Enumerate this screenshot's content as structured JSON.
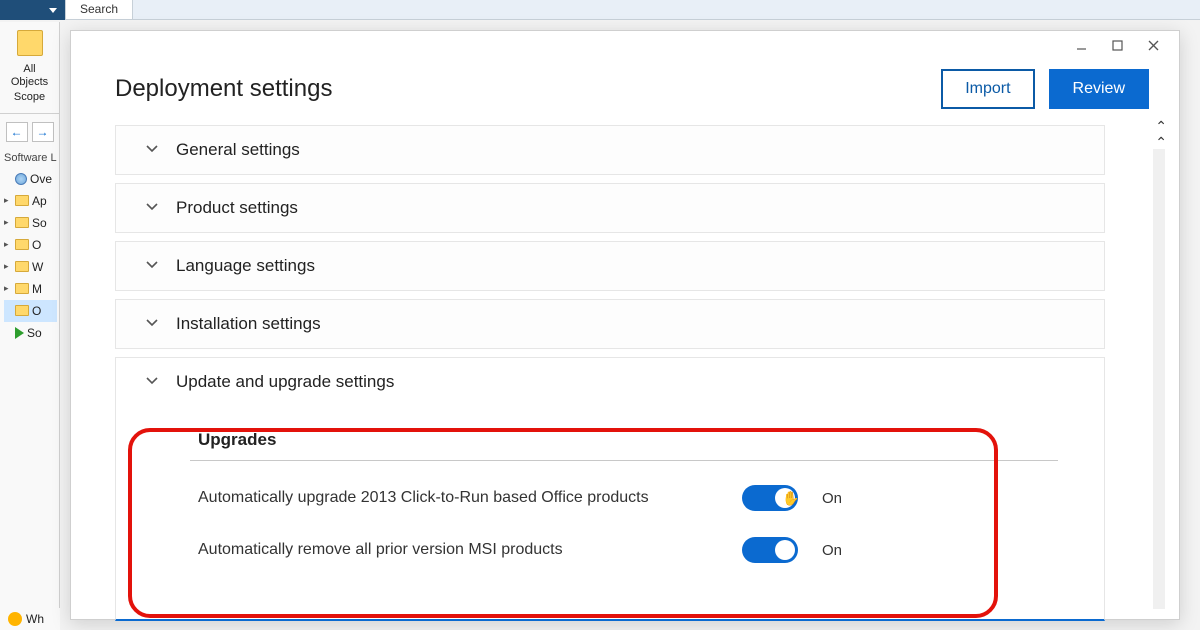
{
  "ribbon": {
    "search_tab": "Search"
  },
  "sidebar": {
    "big_button_line1": "All",
    "big_button_line2": "Objects",
    "scope_label": "Scope",
    "section_label": "Software Li",
    "items": [
      {
        "label": "Ove",
        "kind": "globe",
        "expander": ""
      },
      {
        "label": "Ap",
        "kind": "folder",
        "expander": "▸"
      },
      {
        "label": "So",
        "kind": "folder",
        "expander": "▸"
      },
      {
        "label": "O",
        "kind": "folder",
        "expander": "▸"
      },
      {
        "label": "W",
        "kind": "folder",
        "expander": "▸"
      },
      {
        "label": "M",
        "kind": "folder",
        "expander": "▸"
      },
      {
        "label": "O",
        "kind": "folder",
        "expander": "",
        "selected": true
      },
      {
        "label": "So",
        "kind": "play",
        "expander": ""
      }
    ],
    "bottom": "Wh"
  },
  "dialog": {
    "title": "Deployment settings",
    "buttons": {
      "import": "Import",
      "review": "Review"
    },
    "panels": {
      "general": "General settings",
      "product": "Product settings",
      "language": "Language settings",
      "installation": "Installation settings",
      "update": "Update and upgrade settings"
    },
    "upgrades": {
      "heading": "Upgrades",
      "rows": [
        {
          "label": "Automatically upgrade 2013 Click-to-Run based Office products",
          "state": "On"
        },
        {
          "label": "Automatically remove all prior version MSI products",
          "state": "On"
        }
      ]
    }
  }
}
